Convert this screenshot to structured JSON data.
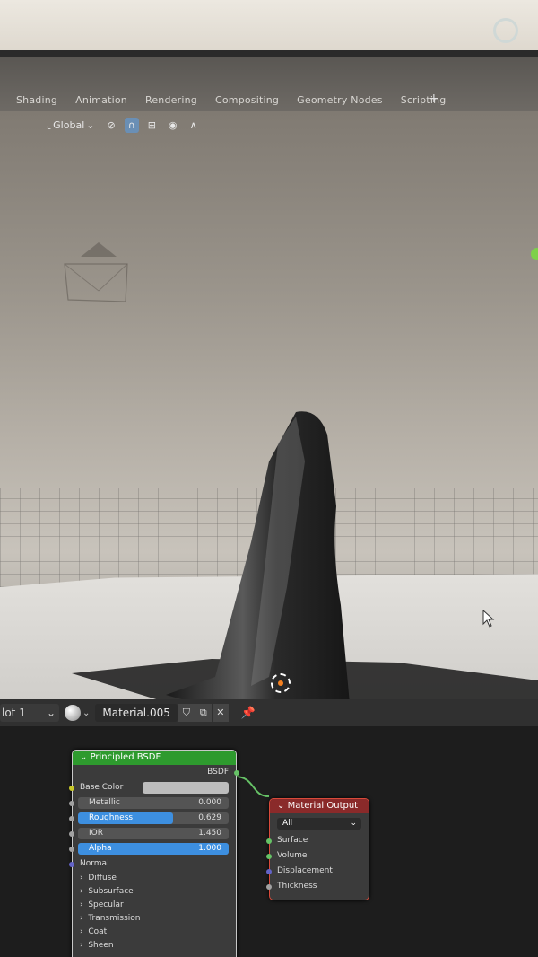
{
  "workspace_tabs": [
    "Shading",
    "Animation",
    "Rendering",
    "Compositing",
    "Geometry Nodes",
    "Scripting"
  ],
  "add_tab": "+",
  "viewport_toolbar": {
    "transform_orientation": "Global",
    "dropdown": "⌄"
  },
  "node_header": {
    "slot": "lot 1",
    "material_name": "Material.005"
  },
  "bsdf_node": {
    "title": "Principled BSDF",
    "output_label": "BSDF",
    "base_color": "Base Color",
    "metallic_label": "Metallic",
    "metallic_value": "0.000",
    "roughness_label": "Roughness",
    "roughness_value": "0.629",
    "roughness": 0.629,
    "ior_label": "IOR",
    "ior_value": "1.450",
    "alpha_label": "Alpha",
    "alpha_value": "1.000",
    "alpha": 1.0,
    "normal": "Normal",
    "panels": [
      "Diffuse",
      "Subsurface",
      "Specular",
      "Transmission",
      "Coat",
      "Sheen"
    ]
  },
  "output_node": {
    "title": "Material Output",
    "target": "All",
    "inputs": [
      "Surface",
      "Volume",
      "Displacement",
      "Thickness"
    ]
  },
  "colors": {
    "accent_blue": "#3d8fe0",
    "bsdf_header": "#2e9a2e",
    "output_header": "#8a2a2a",
    "origin_orange": "#f48020"
  }
}
